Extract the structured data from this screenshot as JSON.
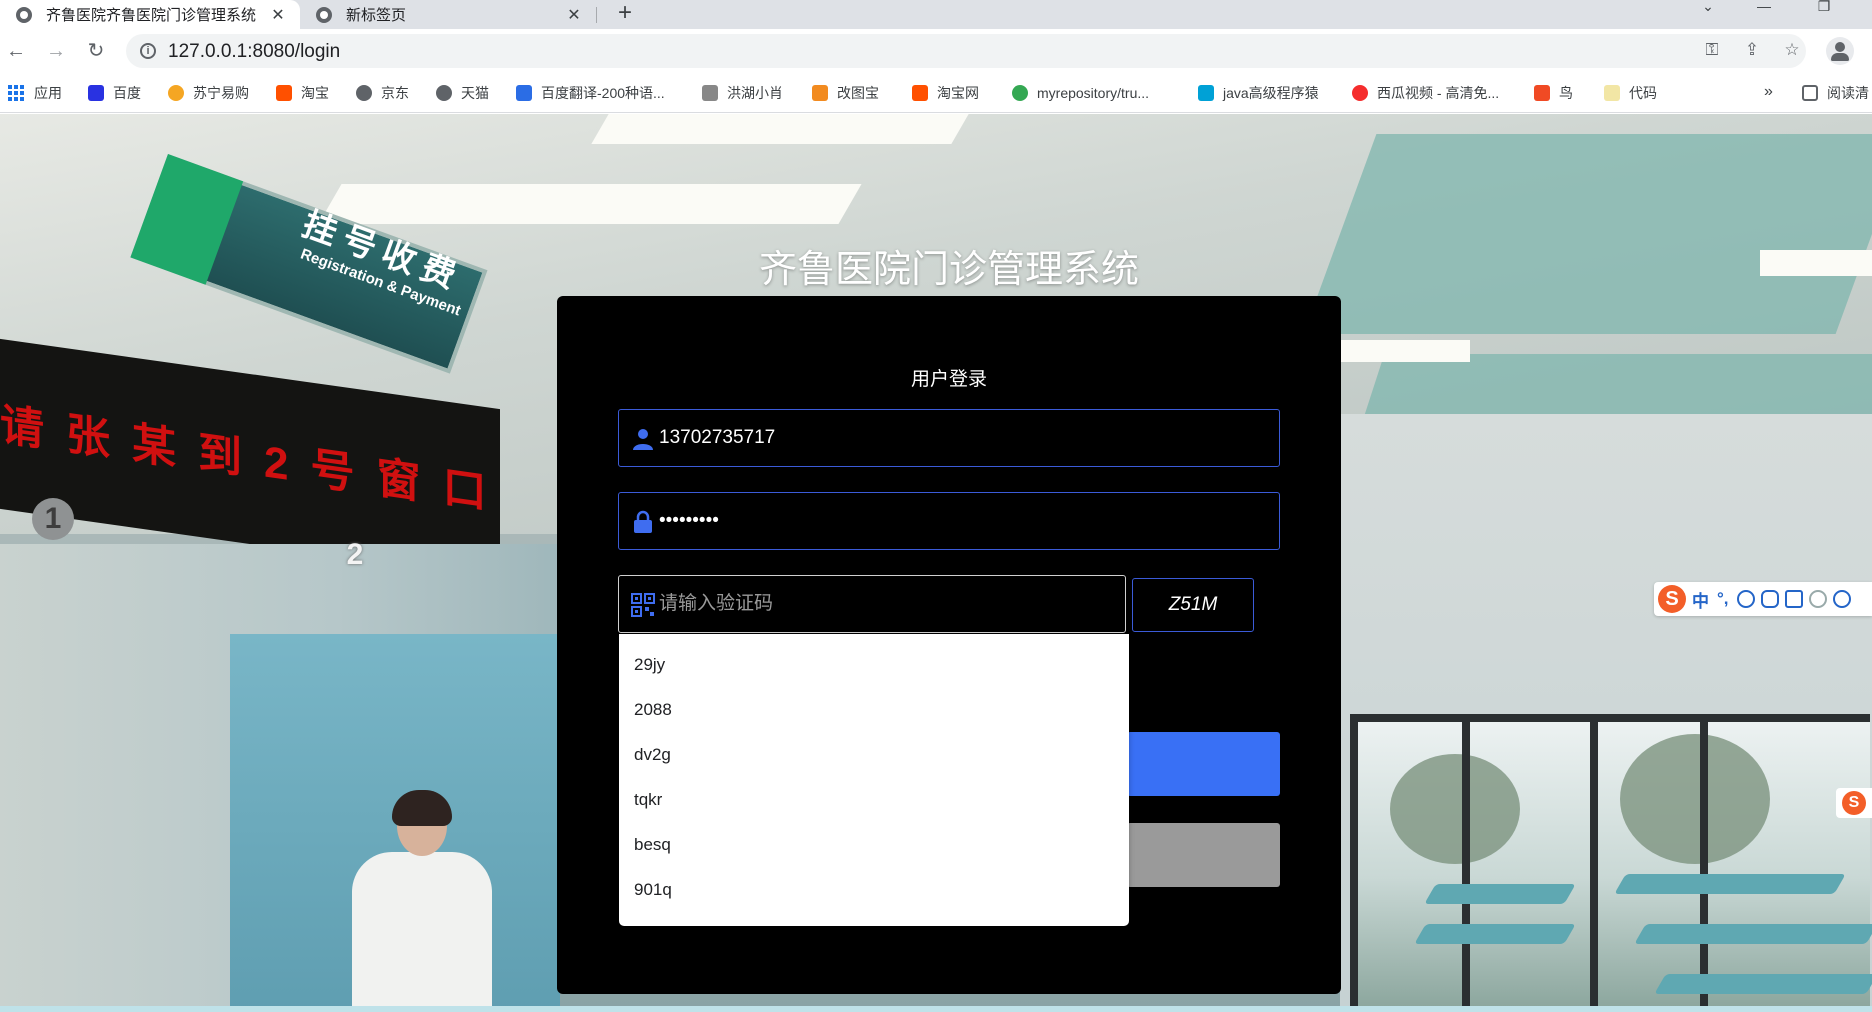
{
  "browser": {
    "tabs": [
      {
        "title": "齐鲁医院齐鲁医院门诊管理系统",
        "close": "✕"
      },
      {
        "title": "新标签页",
        "close": "✕"
      }
    ],
    "new_tab": "+",
    "window_controls": {
      "collapse": "⌄",
      "minimize": "—",
      "restore": "❐"
    },
    "address": "127.0.0.1:8080/login",
    "nav": {
      "back": "←",
      "forward": "→",
      "reload": "↻"
    },
    "omnibox_icons": {
      "key": "⚿",
      "share": "⇪",
      "star": "☆"
    },
    "bookmarks": [
      {
        "label": "应用",
        "color": "#1a73e8"
      },
      {
        "label": "百度",
        "color": "#2932e1"
      },
      {
        "label": "苏宁易购",
        "color": "#f5a623"
      },
      {
        "label": "淘宝",
        "color": "#ff5000"
      },
      {
        "label": "京东",
        "color": "#5f6368"
      },
      {
        "label": "天猫",
        "color": "#5f6368"
      },
      {
        "label": "百度翻译-200种语...",
        "color": "#2b6de5"
      },
      {
        "label": "洪湖小肖",
        "color": "#888888"
      },
      {
        "label": "改图宝",
        "color": "#f28b20"
      },
      {
        "label": "淘宝网",
        "color": "#ff5000"
      },
      {
        "label": "myrepository/tru...",
        "color": "#34a853"
      },
      {
        "label": "java高级程序猿",
        "color": "#00a1d6"
      },
      {
        "label": "西瓜视频 - 高清免...",
        "color": "#f52d2d"
      },
      {
        "label": "鸟",
        "color": "#f04a24"
      },
      {
        "label": "代码",
        "color": "#f2e6a5"
      }
    ],
    "bookmarks_more": "»",
    "reading_list": "阅读清"
  },
  "background": {
    "sign_main": "挂号收费",
    "sign_sub": "Registration & Payment",
    "led_text": "请张某到2号窗口",
    "badge_1": "1",
    "badge_2": "2"
  },
  "page": {
    "system_title": "齐鲁医院门诊管理系统"
  },
  "login": {
    "title": "用户登录",
    "username_value": "13702735717",
    "password_value": "123456789",
    "captcha_placeholder": "请输入验证码",
    "captcha_code": "Z51M"
  },
  "autocomplete": {
    "items": [
      "29jy",
      "2088",
      "dv2g",
      "tqkr",
      "besq",
      "901q"
    ]
  },
  "ime": {
    "logo": "S",
    "mode": "中",
    "punct": "°,"
  },
  "colors": {
    "accent_blue": "#3970f5",
    "field_border": "#3b5bd8",
    "reset_gray": "#9a9a9a",
    "panel_black": "#000000"
  }
}
